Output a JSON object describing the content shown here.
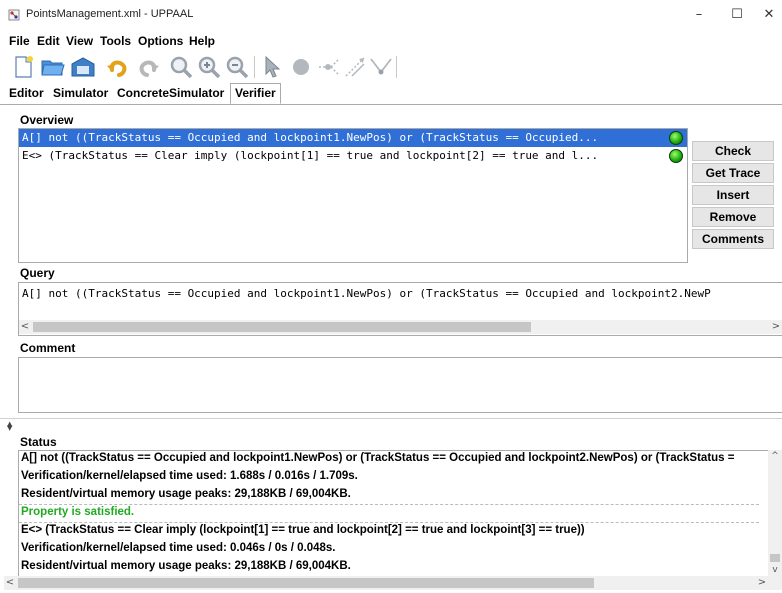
{
  "window": {
    "title": "PointsManagement.xml - UPPAAL",
    "minimize": "–",
    "maximize": "☐",
    "close": "✕"
  },
  "menu": [
    "File",
    "Edit",
    "View",
    "Tools",
    "Options",
    "Help"
  ],
  "toolbar": {
    "icons": [
      "new-icon",
      "open-icon",
      "save-icon",
      "undo-icon",
      "redo-icon",
      "zoom-icon",
      "zoom-in-icon",
      "zoom-out-icon",
      "select-icon",
      "location-icon",
      "branch-icon",
      "edge-icon",
      "nail-icon"
    ]
  },
  "tabs": [
    "Editor",
    "Simulator",
    "ConcreteSimulator",
    "Verifier"
  ],
  "active_tab": "Verifier",
  "overview": {
    "title": "Overview",
    "queries": [
      {
        "text": "A[] not ((TrackStatus == Occupied and lockpoint1.NewPos) or (TrackStatus == Occupied...",
        "selected": true,
        "status": "satisfied"
      },
      {
        "text": "E<> (TrackStatus == Clear imply (lockpoint[1] == true and lockpoint[2] == true and l...",
        "selected": false,
        "status": "satisfied"
      }
    ]
  },
  "buttons": {
    "check": "Check",
    "get_trace": "Get Trace",
    "insert": "Insert",
    "remove": "Remove",
    "comments": "Comments"
  },
  "query": {
    "title": "Query",
    "text": "A[] not ((TrackStatus == Occupied and lockpoint1.NewPos) or (TrackStatus == Occupied and lockpoint2.NewP"
  },
  "comment": {
    "title": "Comment",
    "text": ""
  },
  "status": {
    "title": "Status",
    "lines": [
      {
        "text": "A[] not ((TrackStatus == Occupied and lockpoint1.NewPos) or (TrackStatus == Occupied and lockpoint2.NewPos) or (TrackStatus =",
        "color": "#000000"
      },
      {
        "text": "Verification/kernel/elapsed time used: 1.688s / 0.016s / 1.709s.",
        "color": "#000000"
      },
      {
        "text": "Resident/virtual memory usage peaks: 29,188KB / 69,004KB.",
        "color": "#000000"
      },
      {
        "text": "Property is satisfied.",
        "color": "#22aa22"
      },
      {
        "text": "E<> (TrackStatus == Clear imply (lockpoint[1] == true and lockpoint[2] == true and lockpoint[3] == true))",
        "color": "#000000"
      },
      {
        "text": "Verification/kernel/elapsed time used: 0.046s / 0s / 0.048s.",
        "color": "#000000"
      },
      {
        "text": "Resident/virtual memory usage peaks: 29,188KB / 69,004KB.",
        "color": "#000000"
      }
    ]
  },
  "colors": {
    "selection": "#2f6fd6",
    "satisfied_dot": "#22b014",
    "satisfied_text": "#22aa22"
  }
}
